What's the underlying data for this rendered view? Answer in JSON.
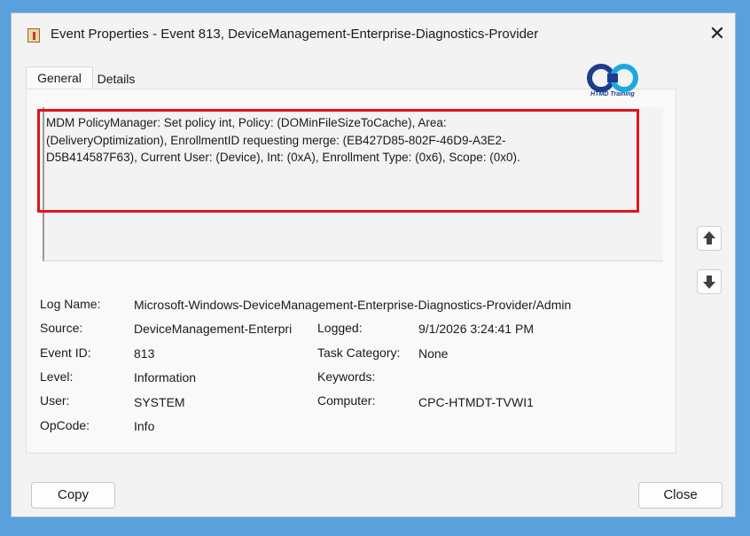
{
  "window": {
    "title": "Event Properties - Event 813, DeviceManagement-Enterprise-Diagnostics-Provider",
    "close_glyph": "✕"
  },
  "tabs": [
    {
      "label": "General",
      "selected": true
    },
    {
      "label": "Details",
      "selected": false
    }
  ],
  "logo": {
    "caption": "HTMD Training"
  },
  "description": {
    "line1": "MDM PolicyManager: Set policy int, Policy: (DOMinFileSizeToCache), Area:",
    "line2": "(DeliveryOptimization), EnrollmentID requesting merge: (EB427D85-802F-46D9-A3E2-",
    "line3": "D5B414587F63), Current User: (Device), Int: (0xA), Enrollment Type: (0x6), Scope: (0x0)."
  },
  "fields": {
    "log_name": {
      "label": "Log Name:",
      "value": "Microsoft-Windows-DeviceManagement-Enterprise-Diagnostics-Provider/Admin"
    },
    "source": {
      "label": "Source:",
      "value": "DeviceManagement-Enterpri"
    },
    "logged": {
      "label": "Logged:",
      "value": "9/1/2026 3:24:41 PM"
    },
    "event_id": {
      "label": "Event ID:",
      "value": "813"
    },
    "task_category": {
      "label": "Task Category:",
      "value": "None"
    },
    "level": {
      "label": "Level:",
      "value": "Information"
    },
    "keywords": {
      "label": "Keywords:",
      "value": ""
    },
    "user": {
      "label": "User:",
      "value": "SYSTEM"
    },
    "computer": {
      "label": "Computer:",
      "value": "CPC-HTMDT-TVWI1"
    },
    "opcode": {
      "label": "OpCode:",
      "value": "Info"
    }
  },
  "nav": {
    "up_icon": "arrow-up-icon",
    "down_icon": "arrow-down-icon"
  },
  "buttons": {
    "copy": "Copy",
    "close": "Close"
  },
  "colors": {
    "highlight": "#e0141e",
    "background": "#5aa0dc",
    "logo_blue": "#1c3c8c"
  }
}
